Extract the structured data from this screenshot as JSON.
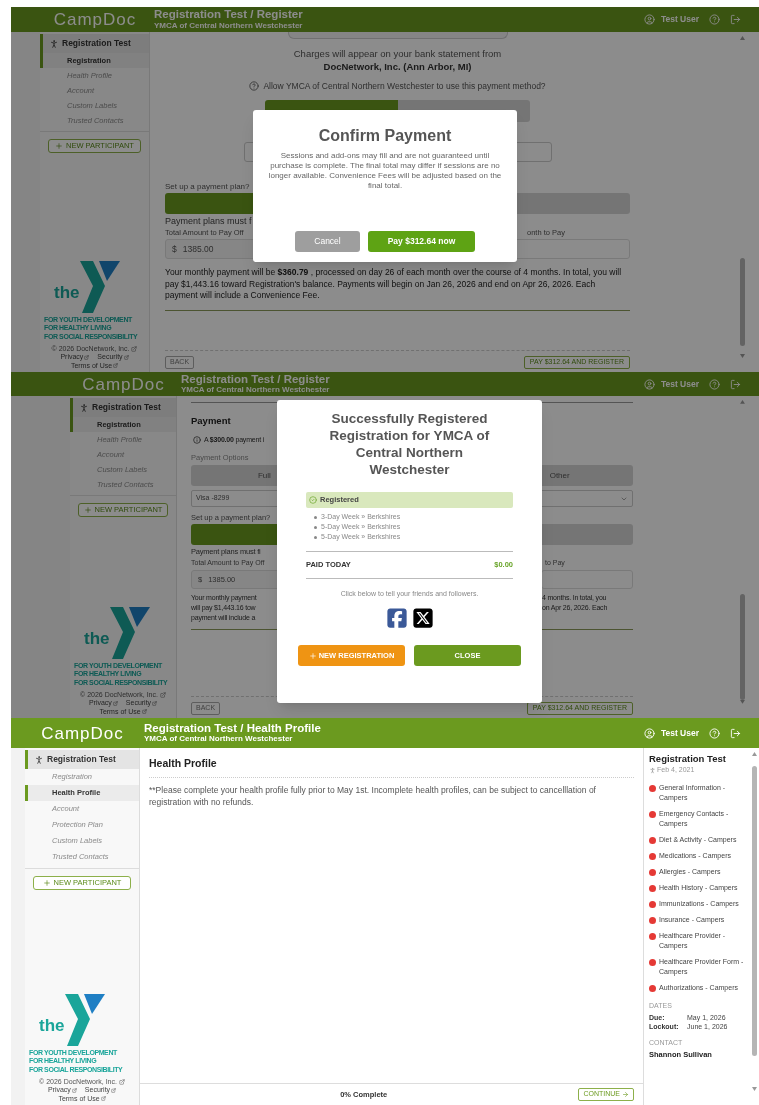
{
  "screens": [
    {
      "kind": "payment_confirm",
      "header": {
        "logo": "CampDoc",
        "title": "Registration Test / Register",
        "subtitle": "YMCA of Central Northern Westchester",
        "user": "Test User"
      },
      "sidebar": {
        "participant": "Registration Test",
        "items": [
          {
            "label": "Registration",
            "selected": true
          },
          {
            "label": "Health Profile",
            "selected": false
          },
          {
            "label": "Account",
            "selected": false
          },
          {
            "label": "Custom Labels",
            "selected": false
          },
          {
            "label": "Trusted Contacts",
            "selected": false
          }
        ],
        "new_button": "NEW PARTICIPANT",
        "logo_word": "the",
        "taglines": [
          "FOR YOUTH DEVELOPMENT",
          "FOR HEALTHY LIVING",
          "FOR SOCIAL RESPONSIBILITY"
        ],
        "copyright": "© 2026 DocNetwork, Inc.",
        "links": [
          "Privacy",
          "Security",
          "Terms of Use"
        ]
      },
      "content": {
        "statement": "Charges will appear on your bank statement from",
        "merchant": "DocNetwork, Inc. (Ann Arbor, MI)",
        "allow_question": "Allow YMCA of Central Northern Westchester to use this payment method?",
        "allow_options": [
          {
            "selected": true
          },
          {
            "selected": false
          }
        ],
        "plan_question": "Set up a payment plan?",
        "plan_options": [
          {
            "selected": true
          },
          {
            "selected": false
          }
        ],
        "plan_note": "Payment plans must f",
        "total_label": "Total Amount to Pay Off",
        "total_prefix": "$",
        "total_value": "1385.00",
        "month_label": "onth to Pay",
        "summary": "Your monthly payment will be **$360.79** , processed on day 26 of each month over the course of 4 months. In total, you will pay $1,443.16 toward Registration's balance. Payments will begin on Jan 26, 2026 and end on Apr 26, 2026. Each payment will include a Convenience Fee."
      },
      "footer": {
        "back": "BACK",
        "submit": "PAY $312.64 AND REGISTER"
      },
      "modal": {
        "kind": "confirm",
        "title": "Confirm Payment",
        "body": "Sessions and add-ons may fill and are not guaranteed until purchase is complete. The final total may differ if sessions are no longer available. Convenience Fees will be adjusted based on the final total.",
        "cancel": "Cancel",
        "confirm": "Pay $312.64 now"
      }
    },
    {
      "kind": "payment_success",
      "header": {
        "logo": "CampDoc",
        "title": "Registration Test / Register",
        "subtitle": "YMCA of Central Northern Westchester",
        "user": "Test User"
      },
      "sidebar": {
        "participant": "Registration Test",
        "items": [
          {
            "label": "Registration",
            "selected": true
          },
          {
            "label": "Health Profile",
            "selected": false
          },
          {
            "label": "Account",
            "selected": false
          },
          {
            "label": "Custom Labels",
            "selected": false
          },
          {
            "label": "Trusted Contacts",
            "selected": false
          }
        ],
        "new_button": "NEW PARTICIPANT",
        "logo_word": "the",
        "taglines": [
          "FOR YOUTH DEVELOPMENT",
          "FOR HEALTHY LIVING",
          "FOR SOCIAL RESPONSIBILITY"
        ],
        "copyright": "© 2026 DocNetwork, Inc.",
        "links": [
          "Privacy",
          "Security",
          "Terms of Use"
        ]
      },
      "content": {
        "heading": "Payment",
        "notice": "A **$300.00** payment i",
        "options_label": "Payment Options",
        "option_left": "Full",
        "option_right": "Other",
        "card": "Visa -8299",
        "plan_question": "Set up a payment plan?",
        "plan_options": [
          {
            "selected": true
          },
          {
            "selected": false
          }
        ],
        "plan_note": "Payment plans must fi",
        "total_label": "Total Amount to Pay Off",
        "total_prefix": "$",
        "total_value": "1385.00",
        "month_label": "to Pay",
        "summary_left": [
          "Your monthly payment",
          "will pay $1,443.16 tow",
          "payment will include a"
        ],
        "summary_right": [
          "4 months. In total, you",
          "on Apr 26, 2026. Each"
        ]
      },
      "footer": {
        "back": "BACK",
        "submit": "PAY $312.64 AND REGISTER"
      },
      "modal": {
        "kind": "success",
        "title": "Successfully Registered Registration for YMCA of Central Northern Westchester",
        "status": "Registered",
        "items": [
          "3-Day Week » Berkshires",
          "5-Day Week » Berkshires",
          "5-Day Week » Berkshires"
        ],
        "paid_label": "PAID TODAY",
        "paid_value": "$0.00",
        "share_prompt": "Click below to tell your friends and followers.",
        "new_button": "NEW REGISTRATION",
        "close_button": "CLOSE"
      }
    },
    {
      "kind": "health_profile",
      "header": {
        "logo": "CampDoc",
        "title": "Registration Test / Health Profile",
        "subtitle": "YMCA of Central Northern Westchester",
        "user": "Test User"
      },
      "sidebar": {
        "participant": "Registration Test",
        "items": [
          {
            "label": "Registration",
            "selected": false
          },
          {
            "label": "Health Profile",
            "selected": true
          },
          {
            "label": "Account",
            "selected": false
          },
          {
            "label": "Protection Plan",
            "selected": false
          },
          {
            "label": "Custom Labels",
            "selected": false
          },
          {
            "label": "Trusted Contacts",
            "selected": false
          }
        ],
        "new_button": "NEW PARTICIPANT",
        "logo_word": "the",
        "taglines": [
          "FOR YOUTH DEVELOPMENT",
          "FOR HEALTHY LIVING",
          "FOR SOCIAL RESPONSIBILITY"
        ],
        "copyright": "© 2026 DocNetwork, Inc.",
        "links": [
          "Privacy",
          "Security",
          "Terms of Use"
        ]
      },
      "content": {
        "heading": "Health Profile",
        "notice": "**Please complete your health profile fully prior to May 1st. Incomplete health profiles, can be subject to cancelllation of registration with no refunds."
      },
      "footer": {
        "progress": "0% Complete",
        "continue": "CONTINUE"
      },
      "checklist": {
        "title": "Registration Test",
        "date": "Feb 4, 2021",
        "items": [
          {
            "label": "General Information - Campers",
            "color": "#e53935"
          },
          {
            "label": "Emergency Contacts - Campers",
            "color": "#e53935"
          },
          {
            "label": "Diet & Activity - Campers",
            "color": "#e53935"
          },
          {
            "label": "Medications - Campers",
            "color": "#e53935"
          },
          {
            "label": "Allergies - Campers",
            "color": "#e53935"
          },
          {
            "label": "Health History - Campers",
            "color": "#e53935"
          },
          {
            "label": "Immunizations - Campers",
            "color": "#e53935"
          },
          {
            "label": "Insurance - Campers",
            "color": "#e53935"
          },
          {
            "label": "Healthcare Provider - Campers",
            "color": "#e53935"
          },
          {
            "label": "Healthcare Provider Form - Campers",
            "color": "#e53935"
          },
          {
            "label": "Authorizations - Campers",
            "color": "#e53935"
          }
        ],
        "dates_label": "DATES",
        "due_label": "Due:",
        "due": "May 1, 2026",
        "lockout_label": "Lockout:",
        "lockout": "June 1, 2026",
        "contact_label": "CONTACT",
        "contact_name": "Shannon Sullivan"
      }
    }
  ]
}
